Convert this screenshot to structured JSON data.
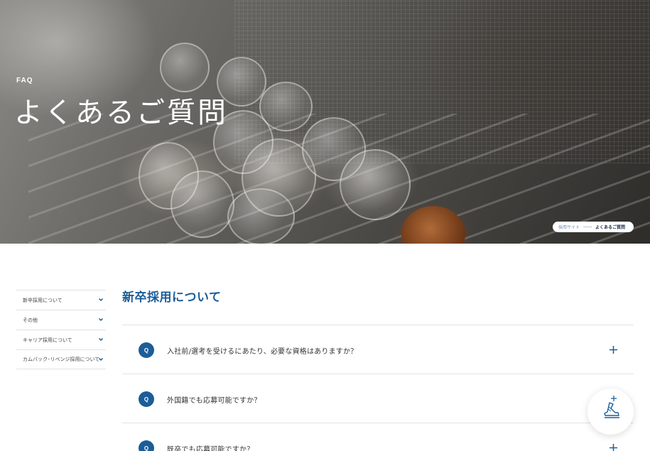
{
  "hero": {
    "label": "FAQ",
    "title": "よくあるご質問"
  },
  "breadcrumb": {
    "items": [
      {
        "label": "採用サイト"
      },
      {
        "label": "よくあるご質問"
      }
    ]
  },
  "sidebar": {
    "items": [
      {
        "label": "新卒採用について"
      },
      {
        "label": "その他"
      },
      {
        "label": "キャリア採用について"
      },
      {
        "label": "カムバック･リベンジ採用について"
      }
    ]
  },
  "main": {
    "section_title": "新卒採用について",
    "faqs": [
      {
        "badge": "Q",
        "question": "入社前/選考を受けるにあたり、必要な資格はありますか？"
      },
      {
        "badge": "Q",
        "question": "外国籍でも応募可能ですか？"
      },
      {
        "badge": "Q",
        "question": "既卒でも応募可能ですか？"
      }
    ]
  },
  "colors": {
    "accent": "#1b5d98",
    "divider": "#dfe3e8"
  },
  "icons": {
    "sidebar_toggle": "chevron-down-icon",
    "faq_toggle": "plus-icon",
    "fab": "sneaker-plus-icon"
  }
}
